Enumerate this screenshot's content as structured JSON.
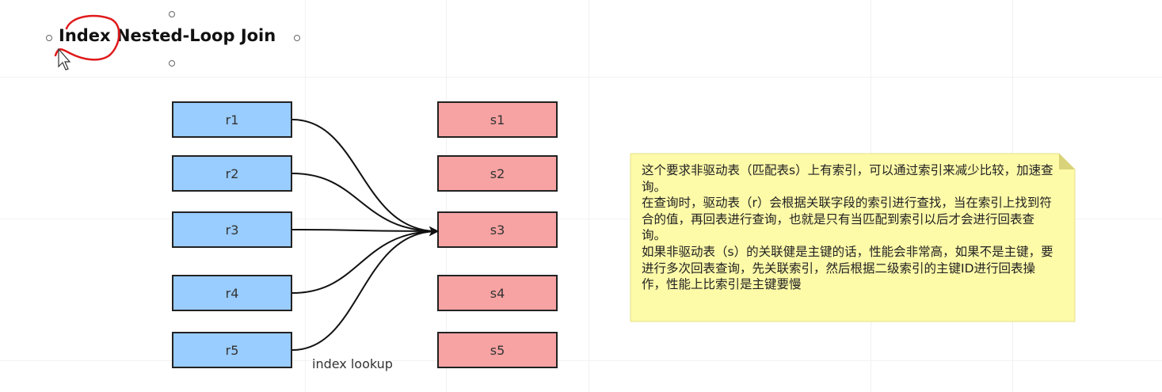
{
  "diagram": {
    "title": "Index Nested-Loop Join",
    "left_boxes": [
      "r1",
      "r2",
      "r3",
      "r4",
      "r5"
    ],
    "right_boxes": [
      "s1",
      "s2",
      "s3",
      "s4",
      "s5"
    ],
    "edge_label": "index lookup",
    "note_lines": "这个要求非驱动表（匹配表s）上有索引，可以通过索引来减少比较，加速查询。\n在查询时，驱动表（r）会根据关联字段的索引进行查找，当在索引上找到符合的值，再回表进行查询，也就是只有当匹配到索引以后才会进行回表查询。\n如果非驱动表（s）的关联健是主键的话，性能会非常高，如果不是主键，要进行多次回表查询，先关联索引，然后根据二级索引的主键ID进行回表操作，性能上比索引是主键要慢",
    "colors": {
      "left_fill": "#99ccff",
      "right_fill": "#f8a3a3",
      "note_fill": "#fdfaa8",
      "annotation": "#e0191b"
    }
  }
}
